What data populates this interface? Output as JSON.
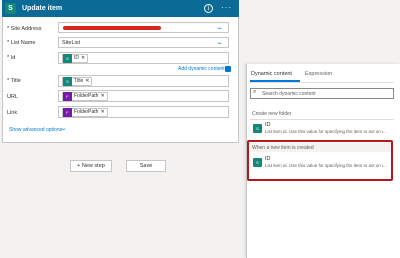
{
  "card": {
    "title": "Update item",
    "logo_letter": "S",
    "fields": {
      "site_address_label": "* Site Address",
      "list_name_label": "* List Name",
      "list_name_value": "SiteList",
      "id_label": "* Id",
      "title_label": "* Title",
      "url_label": "URL",
      "link_label": "Link"
    },
    "tokens": {
      "id_token": "ID",
      "title_token": "Title",
      "url_token": "FolderPath",
      "link_token": "FolderPath"
    },
    "add_dynamic_content": "Add dynamic content",
    "show_advanced_options": "Show advanced options"
  },
  "actions": {
    "new_step": "+ New step",
    "save": "Save"
  },
  "panel": {
    "tabs": [
      "Dynamic content",
      "Expression"
    ],
    "search_placeholder": "Search dynamic content",
    "sections": [
      {
        "header": "Create new folder",
        "items": [
          {
            "title": "ID",
            "description": "List item id. Use this value for specifying the item to act on i..."
          }
        ]
      },
      {
        "header": "When a new item is created",
        "items": [
          {
            "title": "ID",
            "description": "List item id. Use this value for specifying the item to act on i..."
          }
        ]
      }
    ]
  },
  "colors": {
    "header_blue": "#0b6a96",
    "sharepoint_teal": "#138878",
    "token_purple": "#7719aa",
    "accent_blue": "#0078d4",
    "highlight_red": "#b3191b"
  },
  "icons": [
    "sharepoint-icon",
    "info-icon",
    "more-icon",
    "chevron-down-icon",
    "close-icon",
    "search-icon"
  ]
}
